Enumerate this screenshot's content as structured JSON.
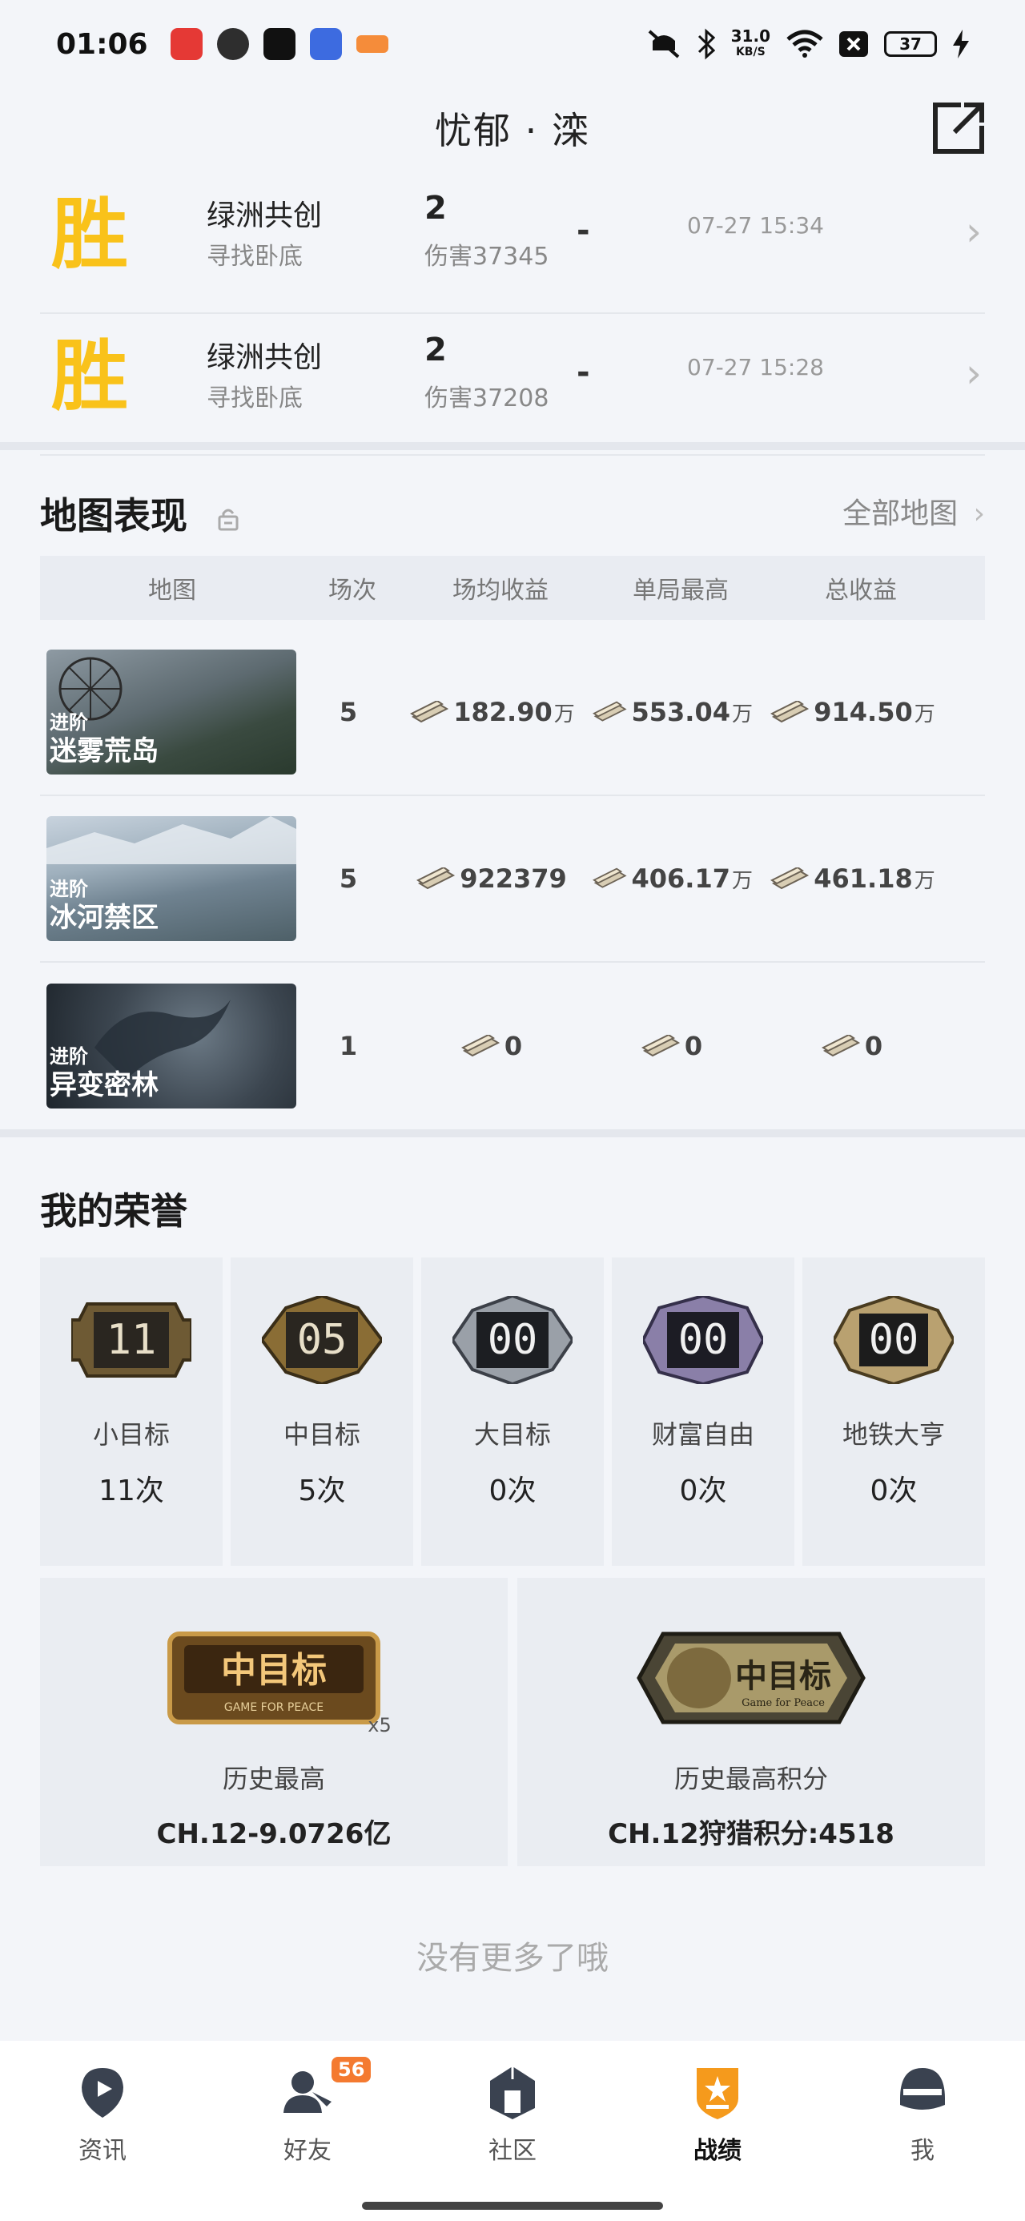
{
  "status_bar": {
    "time": "01:06",
    "net_speed_value": "31.0",
    "net_speed_unit": "KB/S",
    "battery": "37"
  },
  "header": {
    "title": "忧郁 · 滦"
  },
  "matches": [
    {
      "result": "胜",
      "mode": "绿洲共创",
      "sub": "寻找卧底",
      "num": "2",
      "damage": "伤害37345",
      "dash": "-",
      "time": "07-27 15:34"
    },
    {
      "result": "胜",
      "mode": "绿洲共创",
      "sub": "寻找卧底",
      "num": "2",
      "damage": "伤害37208",
      "dash": "-",
      "time": "07-27 15:28"
    }
  ],
  "map_section": {
    "title": "地图表现",
    "all_maps": "全部地图",
    "columns": [
      "地图",
      "场次",
      "场均收益",
      "单局最高",
      "总收益"
    ],
    "rows": [
      {
        "tier": "进阶",
        "name": "迷雾荒岛",
        "count": "5",
        "avg": "182.90",
        "avg_unit": "万",
        "best": "553.04",
        "best_unit": "万",
        "total": "914.50",
        "total_unit": "万"
      },
      {
        "tier": "进阶",
        "name": "冰河禁区",
        "count": "5",
        "avg": "922379",
        "avg_unit": "",
        "best": "406.17",
        "best_unit": "万",
        "total": "461.18",
        "total_unit": "万"
      },
      {
        "tier": "进阶",
        "name": "异变密林",
        "count": "1",
        "avg": "0",
        "avg_unit": "",
        "best": "0",
        "best_unit": "",
        "total": "0",
        "total_unit": ""
      }
    ]
  },
  "honor_section": {
    "title": "我的荣誉",
    "cards": [
      {
        "badge": "11",
        "name": "小目标",
        "count": "11次"
      },
      {
        "badge": "05",
        "name": "中目标",
        "count": "5次"
      },
      {
        "badge": "00",
        "name": "大目标",
        "count": "0次"
      },
      {
        "badge": "00",
        "name": "财富自由",
        "count": "0次"
      },
      {
        "badge": "00",
        "name": "地铁大亨",
        "count": "0次"
      }
    ],
    "big": [
      {
        "badge_text": "中目标",
        "badge_sub": "GAME FOR PEACE",
        "badge_mult": "x5",
        "label": "历史最高",
        "value": "CH.12-9.0726亿"
      },
      {
        "badge_text": "中目标",
        "badge_sub": "Game for Peace",
        "label": "历史最高积分",
        "value": "CH.12狩猎积分:4518"
      }
    ]
  },
  "no_more": "没有更多了哦",
  "nav": {
    "items": [
      {
        "label": "资讯",
        "icon": "news-icon"
      },
      {
        "label": "好友",
        "icon": "friends-icon",
        "badge": "56"
      },
      {
        "label": "社区",
        "icon": "community-icon"
      },
      {
        "label": "战绩",
        "icon": "record-icon"
      },
      {
        "label": "我",
        "icon": "profile-icon"
      }
    ]
  },
  "colors": {
    "win": "#f9c21a",
    "accent": "#f59a1c",
    "badge": "#f47a30"
  }
}
